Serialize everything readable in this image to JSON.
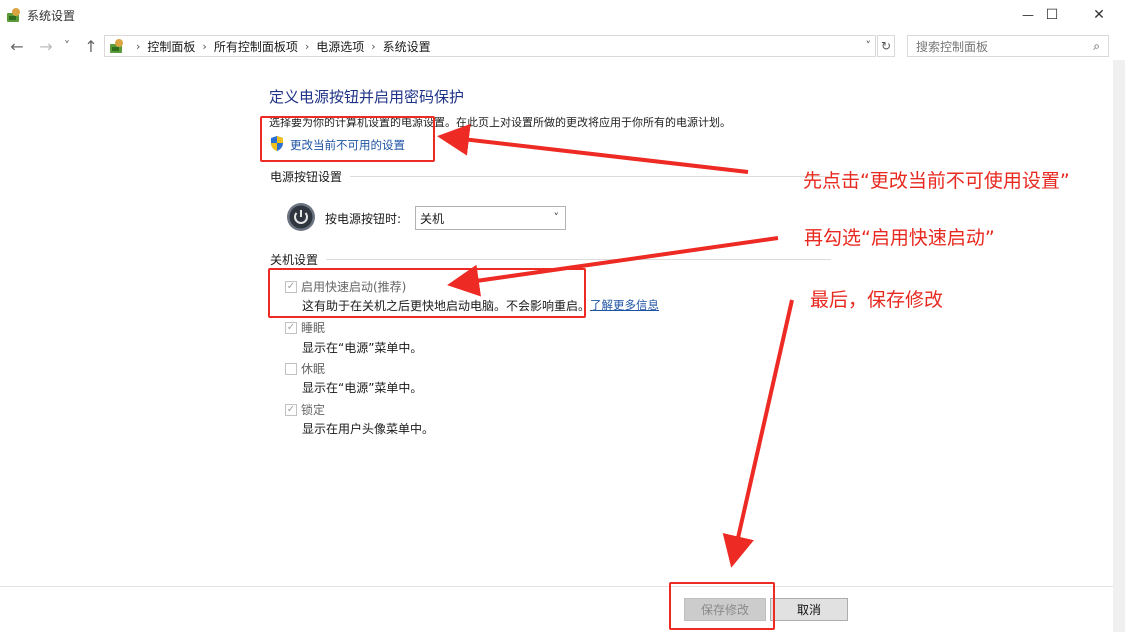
{
  "window": {
    "title": "系统设置",
    "minimize_glyph": "—",
    "maximize_glyph": "☐",
    "close_glyph": "✕"
  },
  "nav": {
    "back_glyph": "←",
    "forward_glyph": "→",
    "recent_glyph": "˅",
    "up_glyph": "↑"
  },
  "breadcrumb": {
    "items": [
      "控制面板",
      "所有控制面板项",
      "电源选项",
      "系统设置"
    ],
    "separator": "›",
    "dropdown_glyph": "˅",
    "refresh_glyph": "↻"
  },
  "search": {
    "placeholder": "搜索控制面板",
    "icon_glyph": "⌕"
  },
  "content": {
    "heading": "定义电源按钮并启用密码保护",
    "description": "选择要为你的计算机设置的电源设置。在此页上对设置所做的更改将应用于你所有的电源计划。",
    "change_link": "更改当前不可用的设置",
    "power_group_title": "电源按钮设置",
    "power_button_label": "按电源按钮时:",
    "power_button_value": "关机",
    "shutdown_group_title": "关机设置",
    "options": [
      {
        "label": "启用快速启动(推荐)",
        "desc": "这有助于在关机之后更快地启动电脑。不会影响重启。",
        "checked": true
      },
      {
        "label": "睡眠",
        "desc": "显示在“电源”菜单中。",
        "checked": true
      },
      {
        "label": "休眠",
        "desc": "显示在“电源”菜单中。",
        "checked": false
      },
      {
        "label": "锁定",
        "desc": "显示在用户头像菜单中。",
        "checked": true
      }
    ],
    "learn_more": "了解更多信息"
  },
  "annotations": {
    "step1": "先点击“更改当前不可使用设置”",
    "step2": "再勾选“启用快速启动”",
    "step3": "最后，保存修改",
    "color": "#e8291f"
  },
  "footer": {
    "save_label": "保存修改",
    "cancel_label": "取消"
  },
  "colors": {
    "heading": "#1e3287",
    "link": "#1e53a4",
    "annotation_red": "#ee2a24",
    "check_mark": "✓"
  }
}
